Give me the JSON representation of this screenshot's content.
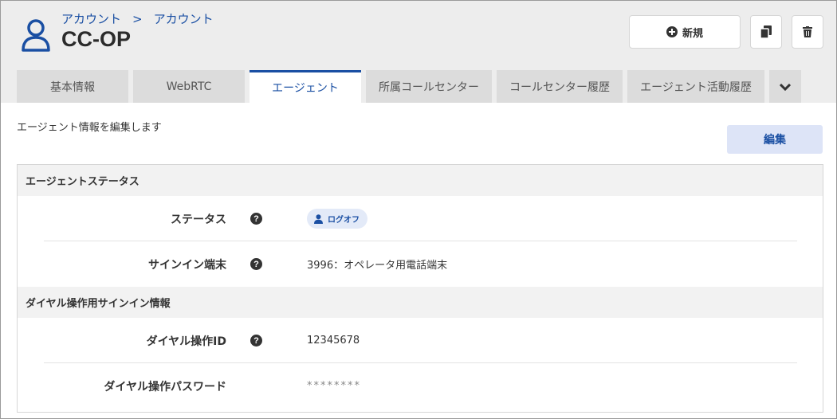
{
  "breadcrumb": {
    "item1": "アカウント",
    "sep": ">",
    "item2": "アカウント"
  },
  "page_title": "CC-OP",
  "toolbar": {
    "new_label": "新規",
    "copy_icon": "copy-icon",
    "delete_icon": "trash-icon"
  },
  "tabs": [
    {
      "label": "基本情報"
    },
    {
      "label": "WebRTC"
    },
    {
      "label": "エージェント",
      "active": true
    },
    {
      "label": "所属コールセンター"
    },
    {
      "label": "コールセンター履歴"
    },
    {
      "label": "エージェント活動履歴"
    }
  ],
  "tabs_more_icon": "chevron-down-icon",
  "description": "エージェント情報を編集します",
  "edit_label": "編集",
  "sections": {
    "agent_status": {
      "title": "エージェントステータス",
      "status": {
        "label": "ステータス",
        "value": "ログオフ",
        "help": "?"
      },
      "signin_terminal": {
        "label": "サインイン端末",
        "value": "3996：オペレータ用電話端末",
        "help": "?"
      }
    },
    "dial_signin": {
      "title": "ダイヤル操作用サインイン情報",
      "dial_id": {
        "label": "ダイヤル操作ID",
        "value": "12345678",
        "help": "?"
      },
      "dial_password": {
        "label": "ダイヤル操作パスワード",
        "value": "********"
      }
    }
  },
  "colors": {
    "accent": "#1a4fa3",
    "header_bg": "#ededed",
    "tab_bg": "#dcdcdc",
    "edit_bg": "#dde4f7"
  }
}
